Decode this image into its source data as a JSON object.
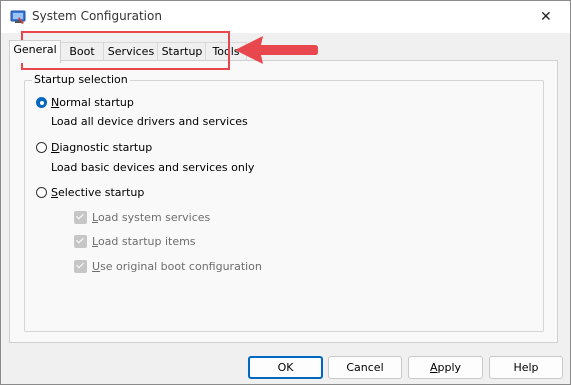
{
  "window": {
    "title": "System Configuration"
  },
  "tabs": [
    {
      "label": "General",
      "active": true
    },
    {
      "label": "Boot"
    },
    {
      "label": "Services"
    },
    {
      "label": "Startup"
    },
    {
      "label": "Tools"
    }
  ],
  "startup_selection": {
    "legend": "Startup selection",
    "normal": {
      "mnemonic": "N",
      "rest": "ormal startup",
      "description": "Load all device drivers and services",
      "checked": true
    },
    "diagnostic": {
      "mnemonic": "D",
      "rest": "iagnostic startup",
      "description": "Load basic devices and services only",
      "checked": false
    },
    "selective": {
      "mnemonic": "S",
      "rest": "elective startup",
      "checked": false,
      "options": [
        {
          "mnemonic": "L",
          "rest": "oad system services",
          "checked": true,
          "enabled": false
        },
        {
          "mnemonic": "L",
          "rest": "oad startup items",
          "checked": true,
          "enabled": false
        },
        {
          "mnemonic": "U",
          "rest": "se original boot configuration",
          "checked": true,
          "enabled": false
        }
      ]
    }
  },
  "buttons": {
    "ok": "OK",
    "cancel": "Cancel",
    "apply_mnemonic": "A",
    "apply_rest": "pply",
    "help": "Help"
  },
  "annotation": {
    "color": "#e8474e"
  }
}
